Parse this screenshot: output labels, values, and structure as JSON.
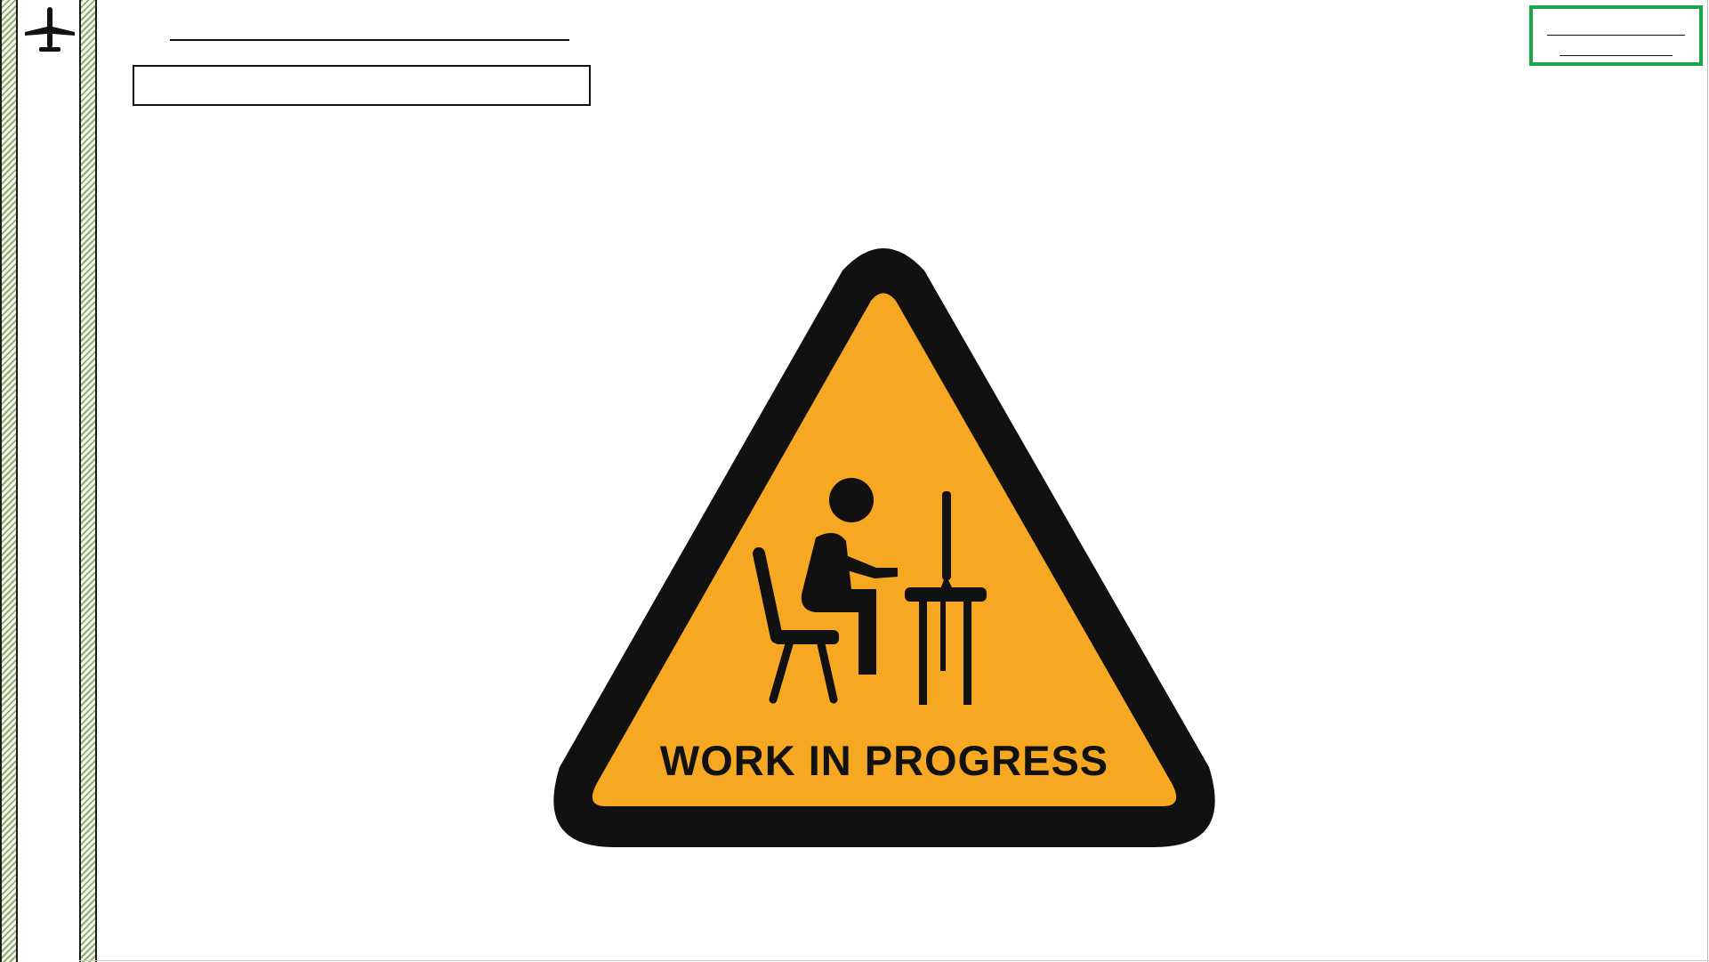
{
  "sign": {
    "label": "WORK IN PROGRESS",
    "icon": "person-at-computer-icon"
  },
  "logo": {
    "icon": "airplane-icon"
  },
  "header": {
    "title_value": ""
  },
  "colors": {
    "sign_fill": "#f7a823",
    "sign_border": "#111111",
    "rail_hatch": "#8fae72",
    "accent_green": "#1ea54b"
  }
}
